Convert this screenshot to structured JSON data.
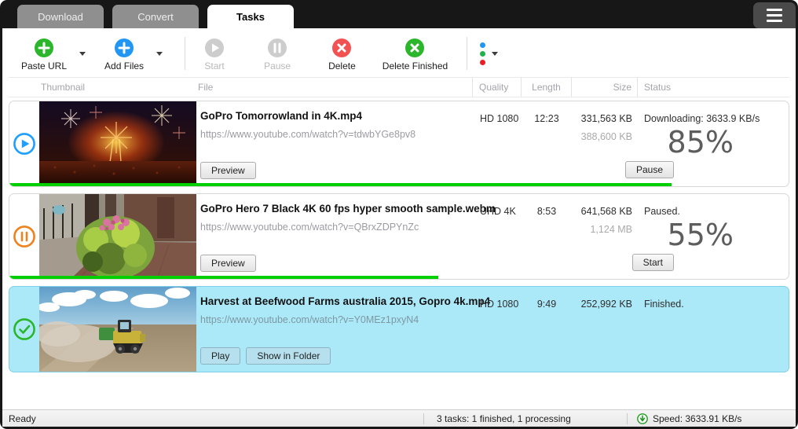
{
  "tabs": [
    {
      "label": "Download",
      "active": false
    },
    {
      "label": "Convert",
      "active": false
    },
    {
      "label": "Tasks",
      "active": true
    }
  ],
  "toolbar": {
    "paste_url_label": "Paste URL",
    "add_files_label": "Add Files",
    "start_label": "Start",
    "pause_label": "Pause",
    "delete_label": "Delete",
    "delete_finished_label": "Delete Finished"
  },
  "table_headers": {
    "thumbnail": "Thumbnail",
    "file": "File",
    "quality": "Quality",
    "length": "Length",
    "size": "Size",
    "status": "Status"
  },
  "tasks": [
    {
      "state": "downloading",
      "title": "GoPro  Tomorrowland in 4K.mp4",
      "url": "https://www.youtube.com/watch?v=tdwbYGe8pv8",
      "quality": "HD 1080",
      "length": "12:23",
      "size": "331,563 KB",
      "size_total": "388,600 KB",
      "status": "Downloading: 3633.9 KB/s",
      "percent_label": "85%",
      "progress": 85,
      "preview_label": "Preview",
      "action_label": "Pause"
    },
    {
      "state": "paused",
      "title": "GoPro Hero 7 Black 4K 60 fps hyper smooth sample.webm",
      "url": "https://www.youtube.com/watch?v=QBrxZDPYnZc",
      "quality": "UHD 4K",
      "length": "8:53",
      "size": "641,568 KB",
      "size_total": "1,124 MB",
      "status": "Paused.",
      "percent_label": "55%",
      "progress": 55,
      "preview_label": "Preview",
      "action_label": "Start"
    },
    {
      "state": "finished",
      "selected": true,
      "title": "Harvest at Beefwood Farms australia 2015, Gopro 4k.mp4",
      "url": "https://www.youtube.com/watch?v=Y0MEz1pxyN4",
      "quality": "HD 1080",
      "length": "9:49",
      "size": "252,992 KB",
      "status": "Finished.",
      "play_label": "Play",
      "show_in_folder_label": "Show in Folder"
    }
  ],
  "statusbar": {
    "ready": "Ready",
    "summary": "3 tasks: 1 finished, 1 processing",
    "speed": "Speed: 3633.91 KB/s"
  },
  "colors": {
    "accent_green": "#2bb62b",
    "accent_blue": "#2196f3",
    "accent_red": "#f04a4a",
    "accent_orange": "#f0821e",
    "row_play_blue": "#1e9fff",
    "progress_green": "#00cf00",
    "selected_row_bg": "#ace9f8"
  }
}
